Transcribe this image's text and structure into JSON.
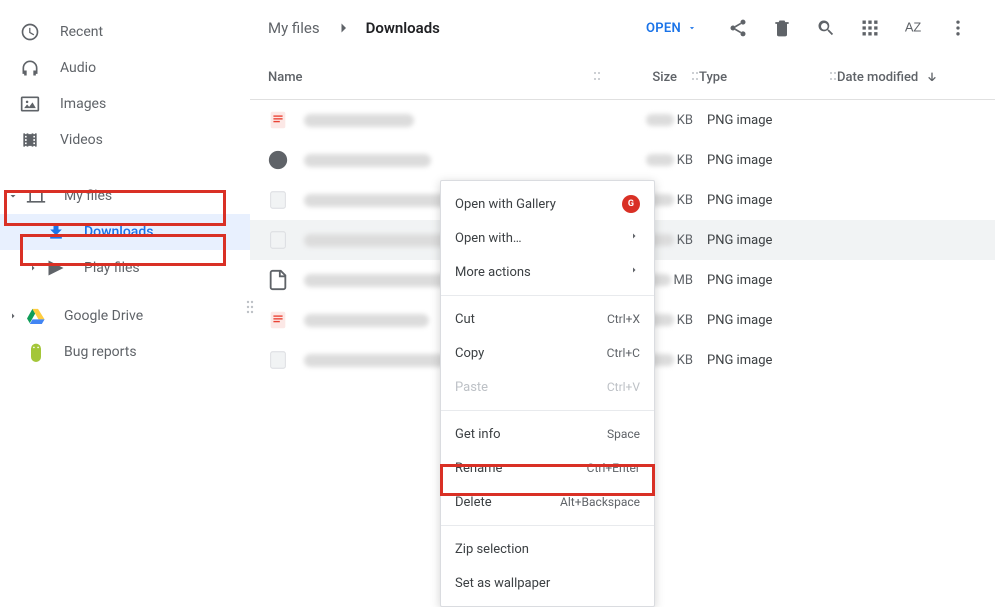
{
  "sidebar": {
    "items": [
      {
        "label": "Recent",
        "icon": "clock-icon"
      },
      {
        "label": "Audio",
        "icon": "headphones-icon"
      },
      {
        "label": "Images",
        "icon": "image-icon"
      },
      {
        "label": "Videos",
        "icon": "video-icon"
      }
    ],
    "tree": [
      {
        "label": "My files",
        "icon": "laptop-icon",
        "expanded": true,
        "highlight": true
      },
      {
        "label": "Downloads",
        "icon": "download-icon",
        "active": true,
        "indent": 1,
        "highlight": true
      },
      {
        "label": "Play files",
        "icon": "play-icon",
        "indent": 1
      },
      {
        "label": "Google Drive",
        "icon": "drive-icon"
      },
      {
        "label": "Bug reports",
        "icon": "bug-icon"
      }
    ]
  },
  "breadcrumb": {
    "parent": "My files",
    "current": "Downloads"
  },
  "toolbar": {
    "open_label": "OPEN",
    "actions": [
      "share-icon",
      "trash-icon",
      "search-icon",
      "view-grid-icon",
      "sort-az-icon",
      "more-vertical-icon"
    ]
  },
  "table": {
    "headers": {
      "name": "Name",
      "size": "Size",
      "type": "Type",
      "date": "Date modified"
    },
    "rows": [
      {
        "size_unit": "KB",
        "type": "PNG image",
        "icon": "red-doc"
      },
      {
        "size_unit": "KB",
        "type": "PNG image",
        "icon": "grey-circle"
      },
      {
        "size_unit": "KB",
        "type": "PNG image",
        "icon": "blank"
      },
      {
        "size_unit": "KB",
        "type": "PNG image",
        "icon": "blank",
        "selected": true
      },
      {
        "size_unit": "MB",
        "type": "PNG image",
        "icon": "file"
      },
      {
        "size_unit": "KB",
        "type": "PNG image",
        "icon": "red-doc"
      },
      {
        "size_unit": "KB",
        "type": "PNG image",
        "icon": "blank"
      }
    ]
  },
  "context_menu": {
    "items": [
      {
        "label": "Open with Gallery",
        "badge": "G"
      },
      {
        "label": "Open with…",
        "submenu": true
      },
      {
        "label": "More actions",
        "submenu": true
      },
      {
        "divider": true
      },
      {
        "label": "Cut",
        "shortcut": "Ctrl+X"
      },
      {
        "label": "Copy",
        "shortcut": "Ctrl+C"
      },
      {
        "label": "Paste",
        "shortcut": "Ctrl+V",
        "disabled": true
      },
      {
        "divider": true
      },
      {
        "label": "Get info",
        "shortcut": "Space"
      },
      {
        "label": "Rename",
        "shortcut": "Ctrl+Enter"
      },
      {
        "label": "Delete",
        "shortcut": "Alt+Backspace",
        "highlight": true
      },
      {
        "divider": true
      },
      {
        "label": "Zip selection"
      },
      {
        "label": "Set as wallpaper"
      }
    ]
  }
}
